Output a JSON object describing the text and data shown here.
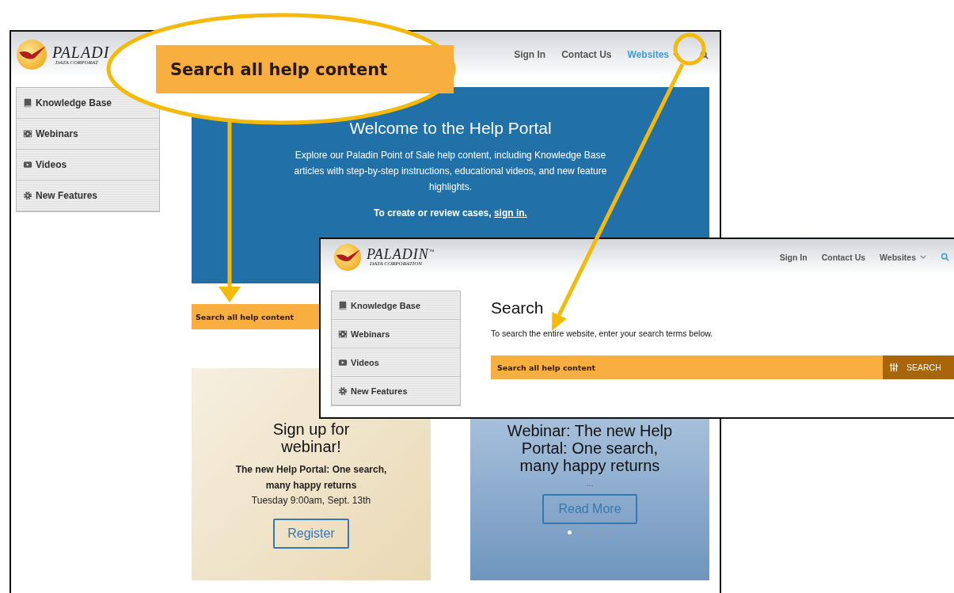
{
  "back_page": {
    "logo": {
      "name": "PALADI",
      "tagline": "DATA CORPORAT"
    },
    "nav": [
      {
        "label": "Sign In",
        "kind": "link",
        "selected": false
      },
      {
        "label": "Contact Us",
        "kind": "link",
        "selected": false
      },
      {
        "label": "Websites",
        "kind": "dropdown",
        "selected": true
      }
    ],
    "sidebar": {
      "items": [
        {
          "label": "Knowledge Base",
          "kind": "book"
        },
        {
          "label": "Webinars",
          "kind": "film"
        },
        {
          "label": "Videos",
          "kind": "video"
        },
        {
          "label": "New Features",
          "kind": "gear"
        }
      ]
    },
    "hero": {
      "title": "Welcome to the Help Portal",
      "text": "Explore our Paladin Point of Sale help content, including Knowledge Base articles with step-by-step instructions, educational videos, and new feature highlights.",
      "cta_text": "To create or review cases,",
      "cta_link": "sign in."
    },
    "search": {
      "placeholder": "Search all help content"
    },
    "cards": [
      {
        "kind": "event",
        "title_lines": [
          "Sign up for",
          "webinar!"
        ],
        "subtitle_lines": [
          "The new Help Portal: One search,",
          "many happy returns"
        ],
        "date": "Tuesday 9:00am, Sept. 13th",
        "button": "Register"
      },
      {
        "kind": "article",
        "title": "Webinar: The new Help Portal: One search, many happy returns",
        "ellipsis": "...",
        "button": "Read More",
        "dots": [
          {
            "selected": true
          },
          {
            "selected": false
          },
          {
            "selected": false
          },
          {
            "selected": false
          },
          {
            "selected": false
          }
        ]
      }
    ]
  },
  "front_page": {
    "logo": {
      "name": "PALADIN",
      "mark": "™",
      "tagline": "DATA CORPORATION"
    },
    "nav": [
      {
        "label": "Sign In",
        "kind": "link",
        "selected": false
      },
      {
        "label": "Contact Us",
        "kind": "link",
        "selected": false
      },
      {
        "label": "Websites",
        "kind": "dropdown",
        "selected": false
      }
    ],
    "sidebar": {
      "items": [
        {
          "label": "Knowledge Base",
          "kind": "book"
        },
        {
          "label": "Webinars",
          "kind": "film"
        },
        {
          "label": "Videos",
          "kind": "video"
        },
        {
          "label": "New Features",
          "kind": "gear"
        }
      ]
    },
    "heading": "Search",
    "description": "To search the entire website, enter your search terms below.",
    "search": {
      "placeholder": "Search all help content",
      "button": "SEARCH"
    }
  },
  "callout": {
    "label": "Search all help content"
  }
}
